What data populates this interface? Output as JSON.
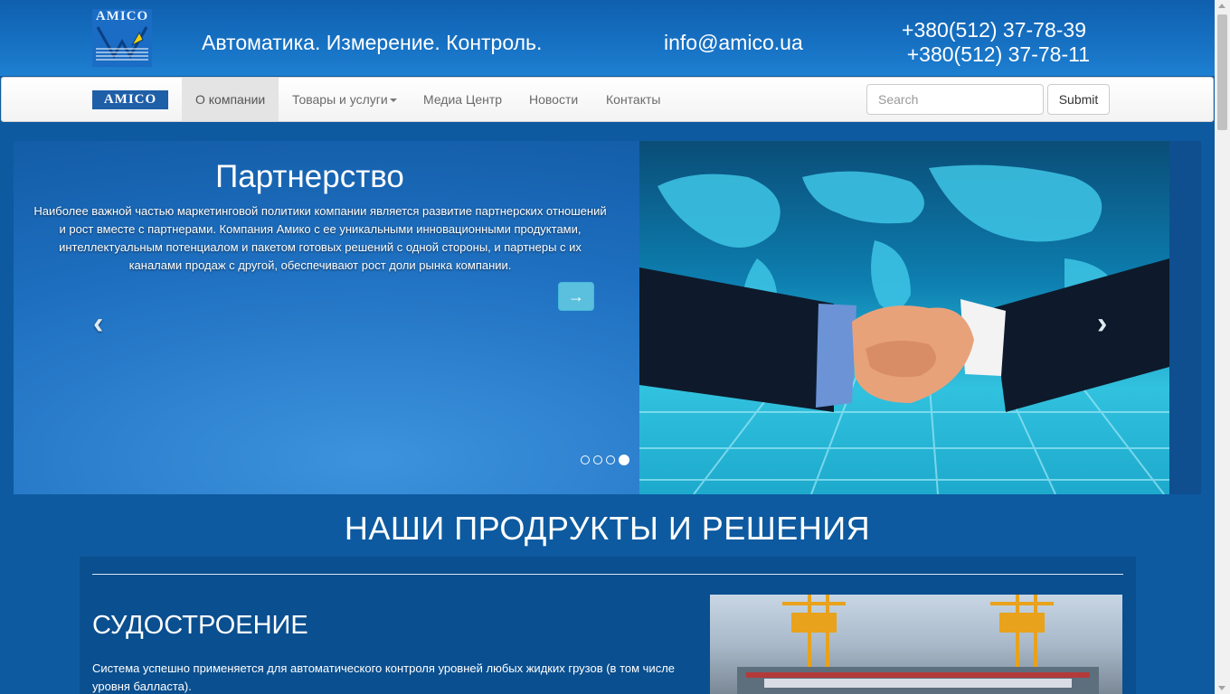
{
  "header": {
    "logo_text": "AMICO",
    "tagline": "Автоматика. Измерение. Контроль.",
    "email": "info@amico.ua",
    "phone_1": "+380(512) 37-78-39",
    "phone_2": "+380(512) 37-78-11"
  },
  "navbar": {
    "brand": "AMICO",
    "items": [
      {
        "label": "О компании",
        "active": true
      },
      {
        "label": "Товары и услуги",
        "dropdown": true
      },
      {
        "label": "Медиа Центр"
      },
      {
        "label": "Новости"
      },
      {
        "label": "Контакты"
      }
    ],
    "search_placeholder": "Search",
    "submit_label": "Submit"
  },
  "carousel": {
    "title": "Партнерство",
    "text": "Наиболее важной частью маркетинговой политики компании является развитие партнерских отношений и рост вместе с партнерами. Компания Амико с ее уникальными инновационными продуктами, интеллектуальным потенциалом и пакетом готовых решений с одной стороны, и партнеры с их каналами продаж с другой, обеспечивают рост доли рынка компании.",
    "arrow_button": "→",
    "prev_icon": "‹",
    "next_icon": "›",
    "slide_count": 4,
    "active_slide": 4
  },
  "products": {
    "section_title": "НАШИ ПРОДРУКТЫ И РЕШЕНИЯ",
    "items": [
      {
        "heading": "СУДОСТРОЕНИЕ",
        "text": "Система успешно применяется для автоматического контроля уровней любых жидких грузов (в том числе уровня балласта)."
      }
    ]
  },
  "colors": {
    "header_blue": "#1670c2",
    "page_blue": "#0d5aa0",
    "info_button": "#5bc0de"
  }
}
